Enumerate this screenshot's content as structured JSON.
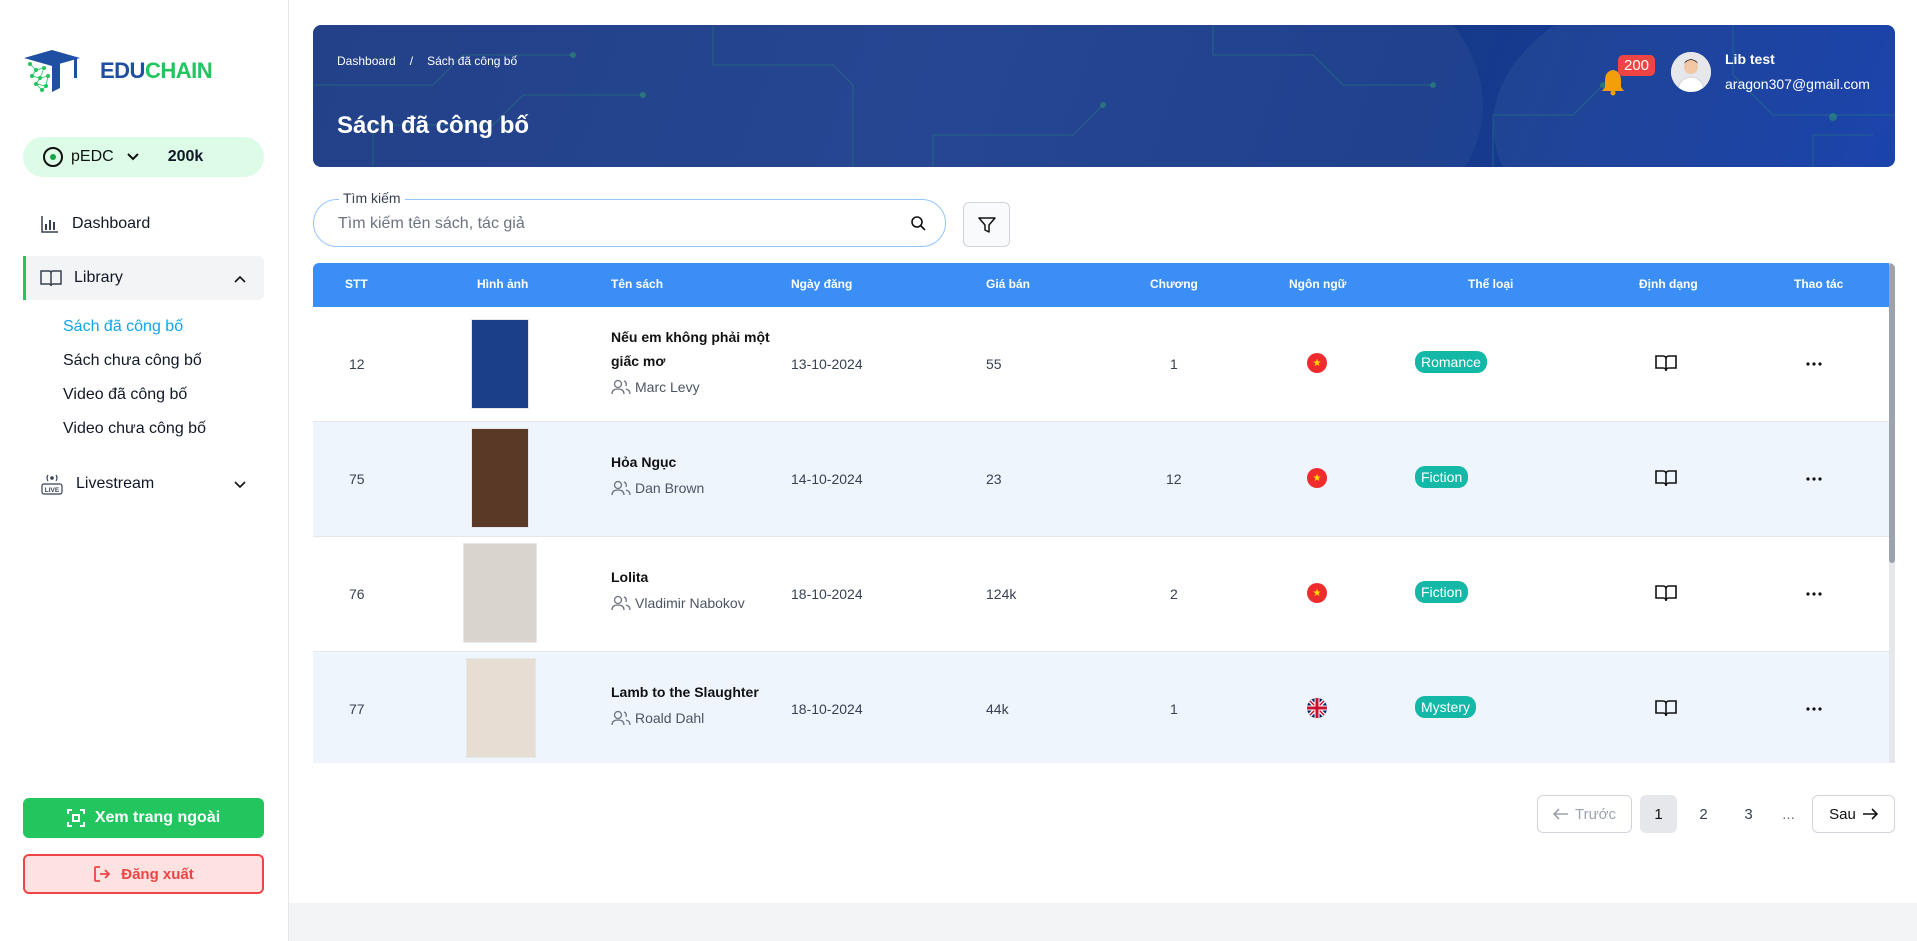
{
  "brand": {
    "part1": "EDU",
    "part2": "CHAIN"
  },
  "wallet": {
    "token": "pEDC",
    "amount": "200k"
  },
  "sidebar": {
    "dashboard": "Dashboard",
    "library": "Library",
    "library_items": [
      "Sách đã công bố",
      "Sách chưa công bố",
      "Video đã công bố",
      "Video chưa công bố"
    ],
    "livestream": "Livestream",
    "view_site": "Xem trang ngoài",
    "logout": "Đăng xuất"
  },
  "header": {
    "breadcrumb": [
      "Dashboard",
      "/",
      "Sách đã công bố"
    ],
    "title": "Sách đã công bố",
    "notifications": "200",
    "user_name": "Lib test",
    "user_email": "aragon307@gmail.com"
  },
  "search": {
    "label": "Tìm kiếm",
    "placeholder": "Tìm kiếm tên sách, tác giả"
  },
  "table": {
    "headers": [
      "STT",
      "Hình ảnh",
      "Tên sách",
      "Ngày đăng",
      "Giá bán",
      "Chương",
      "Ngôn ngữ",
      "Thể loại",
      "Định dạng",
      "Thao tác"
    ],
    "rows": [
      {
        "stt": "12",
        "title": "Nếu em không phải một giấc mơ",
        "author": "Marc Levy",
        "date": "13-10-2024",
        "price": "55",
        "chapters": "1",
        "lang": "vn",
        "genre": "Romance",
        "cover_color": "#1c3f8a"
      },
      {
        "stt": "75",
        "title": "Hỏa Ngục",
        "author": "Dan Brown",
        "date": "14-10-2024",
        "price": "23",
        "chapters": "12",
        "lang": "vn",
        "genre": "Fiction",
        "cover_color": "#5a3a26"
      },
      {
        "stt": "76",
        "title": "Lolita",
        "author": "Vladimir Nabokov",
        "date": "18-10-2024",
        "price": "124k",
        "chapters": "2",
        "lang": "vn",
        "genre": "Fiction",
        "cover_color": "#d9d5cc"
      },
      {
        "stt": "77",
        "title": "Lamb to the Slaughter",
        "author": "Roald Dahl",
        "date": "18-10-2024",
        "price": "44k",
        "chapters": "1",
        "lang": "en",
        "genre": "Mystery",
        "cover_color": "#e8ddd2"
      }
    ]
  },
  "pagination": {
    "prev": "Trước",
    "pages": [
      "1",
      "2",
      "3"
    ],
    "ellipsis": "...",
    "next": "Sau",
    "current": "1"
  },
  "colors": {
    "accent": "#22c55e",
    "table_header": "#3a8ef6",
    "genre": "#14b8a6",
    "banner": "#1e3f8f"
  }
}
